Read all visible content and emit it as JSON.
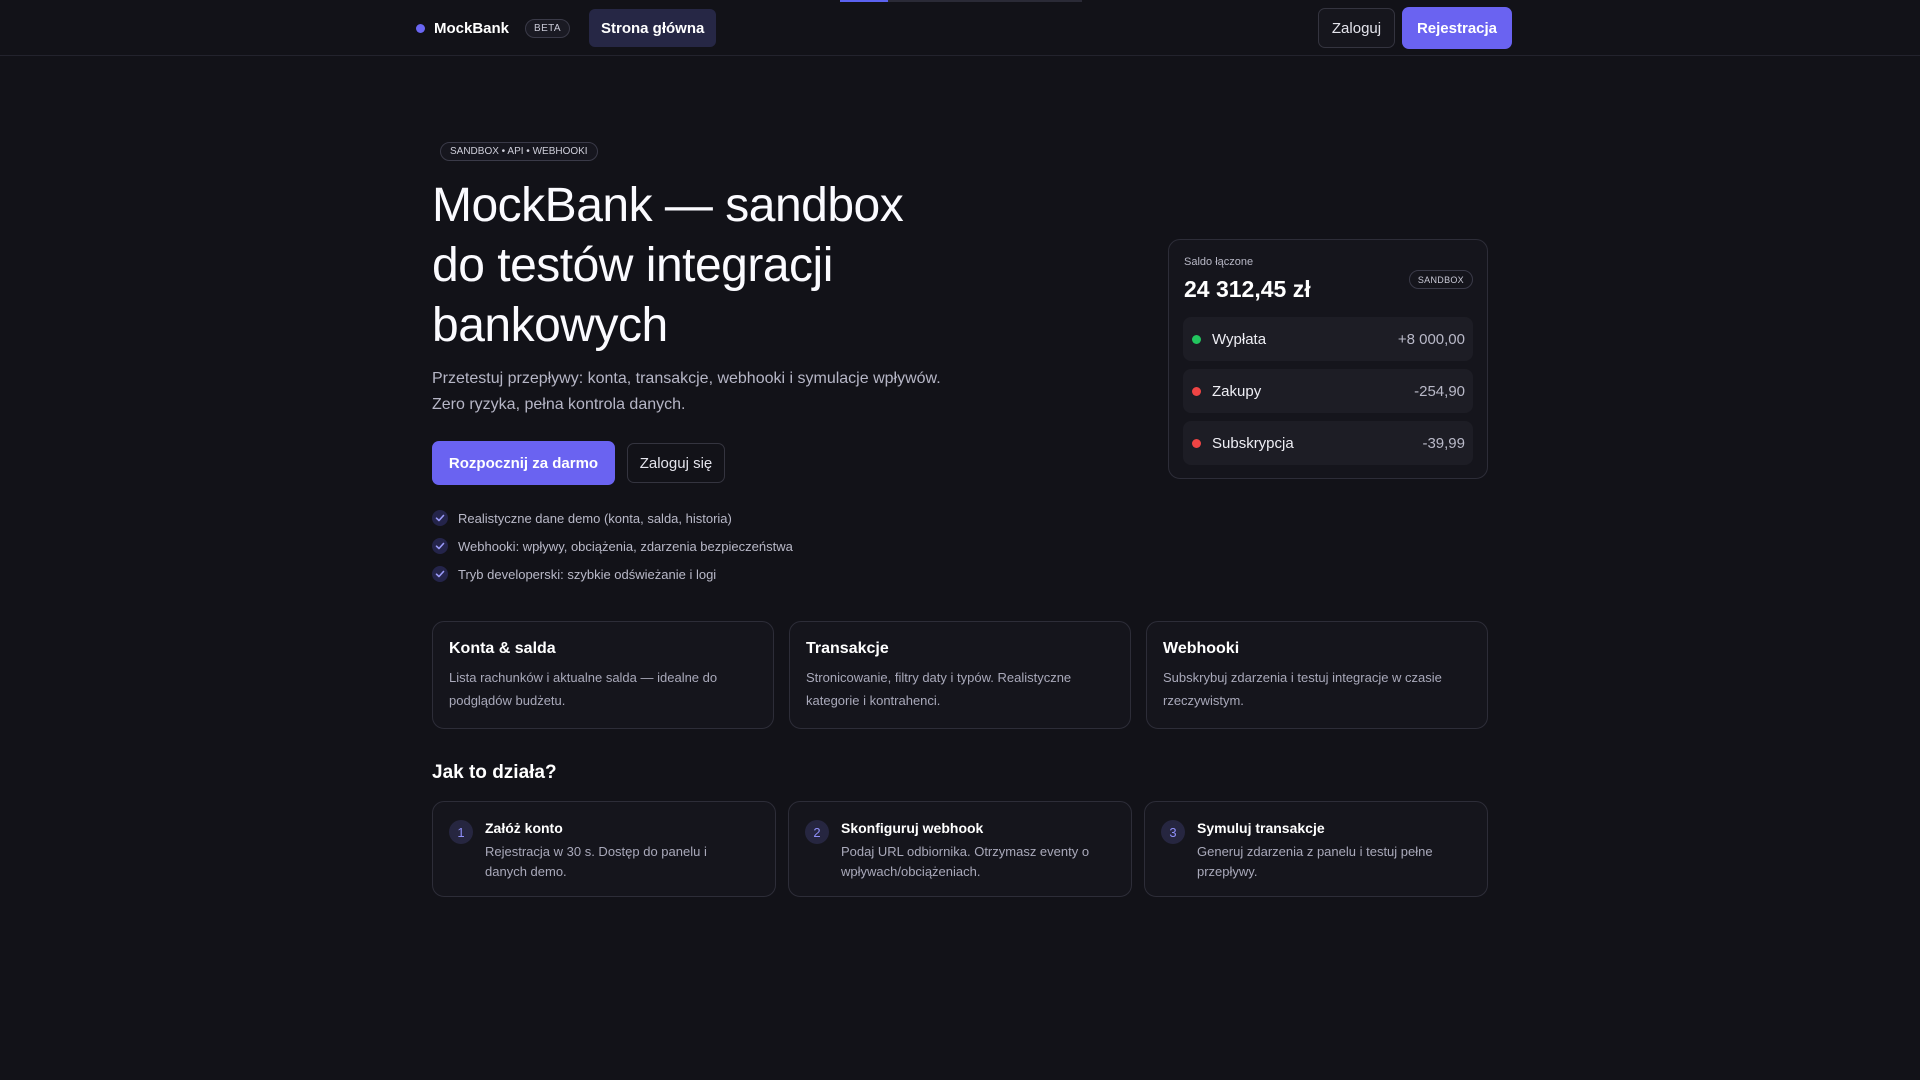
{
  "header": {
    "brand_name": "MockBank",
    "brand_badge": "BETA",
    "nav_home": "Strona główna",
    "login": "Zaloguj",
    "register": "Rejestracja"
  },
  "hero": {
    "pill": "SANDBOX • API • WEBHOOKI",
    "title_line1": "MockBank — sandbox",
    "title_line2": "do testów integracji",
    "title_line3": "bankowych",
    "subtitle_line1": "Przetestuj przepływy: konta, transakcje, webhooki i symulacje wpływów.",
    "subtitle_line2": "Zero ryzyka, pełna kontrola danych.",
    "cta_primary": "Rozpocznij za darmo",
    "cta_secondary": "Zaloguj się",
    "features": [
      "Realistyczne dane demo (konta, salda, historia)",
      "Webhooki: wpływy, obciążenia, zdarzenia bezpieczeństwa",
      "Tryb developerski: szybkie odświeżanie i logi"
    ]
  },
  "balance_card": {
    "label": "Saldo łączone",
    "amount": "24 312,45 zł",
    "badge": "SANDBOX",
    "transactions": [
      {
        "label": "Wypłata",
        "value": "+8 000,00",
        "status_color": "#22c55e"
      },
      {
        "label": "Zakupy",
        "value": "-254,90",
        "status_color": "#ef4444"
      },
      {
        "label": "Subskrypcja",
        "value": "-39,99",
        "status_color": "#ef4444"
      }
    ]
  },
  "feature_cards": [
    {
      "title": "Konta & salda",
      "desc_line1": "Lista rachunków i aktualne salda — idealne do",
      "desc_line2": "podglądów budżetu."
    },
    {
      "title": "Transakcje",
      "desc_line1": "Stronicowanie, filtry daty i typów. Realistyczne",
      "desc_line2": "kategorie i kontrahenci."
    },
    {
      "title": "Webhooki",
      "desc_line1": "Subskrybuj zdarzenia i testuj integracje w czasie",
      "desc_line2": "rzeczywistym."
    }
  ],
  "how_it_works": {
    "title": "Jak to działa?",
    "steps": [
      {
        "num": "1",
        "title": "Załóż konto",
        "desc_line1": "Rejestracja w 30 s. Dostęp do panelu i",
        "desc_line2": "danych demo."
      },
      {
        "num": "2",
        "title": "Skonfiguruj webhook",
        "desc_line1": "Podaj URL odbiornika. Otrzymasz eventy o",
        "desc_line2": "wpływach/obciążeniach."
      },
      {
        "num": "3",
        "title": "Symuluj transakcje",
        "desc_line1": "Generuj zdarzenia z panelu i testuj pełne",
        "desc_line2": "przepływy."
      }
    ]
  },
  "colors": {
    "accent": "#6a63f1",
    "background": "#121218",
    "positive": "#22c55e",
    "negative": "#ef4444"
  }
}
